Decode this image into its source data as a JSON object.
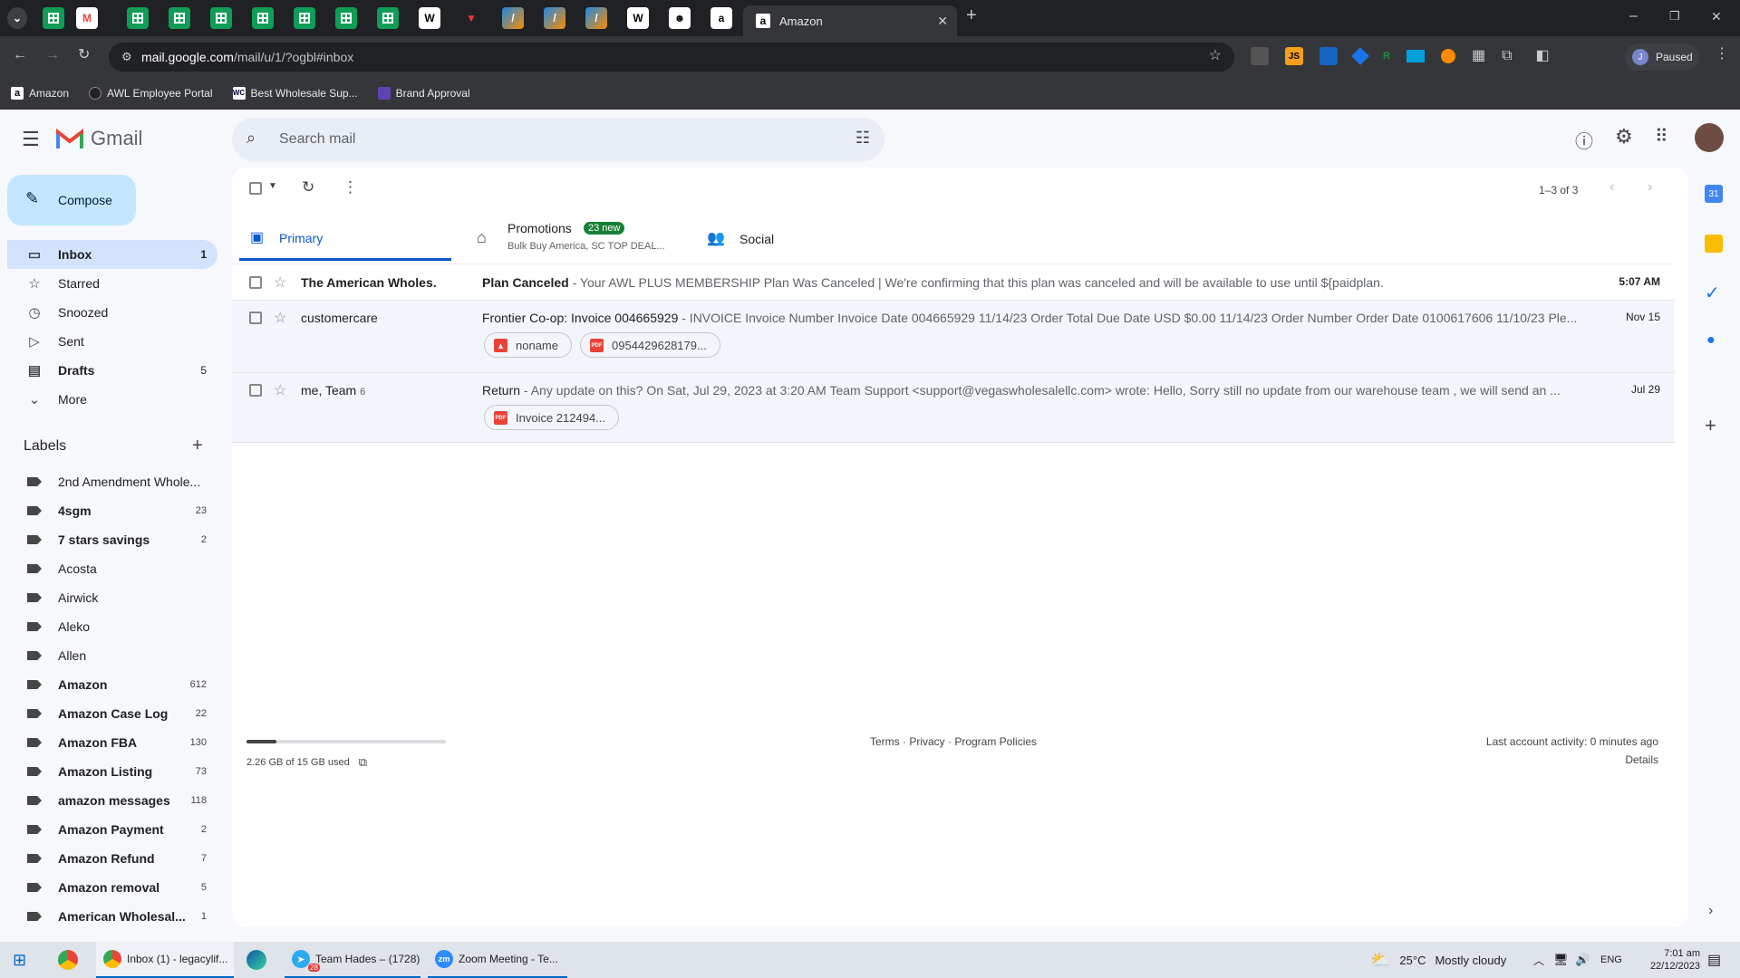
{
  "browser": {
    "active_tab_title": "Amazon",
    "url_host": "mail.google.com",
    "url_path": "/mail/u/1/?ogbl#inbox",
    "profile_status": "Paused",
    "profile_initial": "J",
    "bookmarks": [
      "Amazon",
      "AWL Employee Portal",
      "Best Wholesale Sup...",
      "Brand Approval"
    ]
  },
  "gmail": {
    "brand": "Gmail",
    "search_placeholder": "Search mail",
    "compose_label": "Compose",
    "pagination": "1–3 of 3",
    "nav": [
      {
        "label": "Inbox",
        "count": "1"
      },
      {
        "label": "Starred",
        "count": ""
      },
      {
        "label": "Snoozed",
        "count": ""
      },
      {
        "label": "Sent",
        "count": ""
      },
      {
        "label": "Drafts",
        "count": "5"
      },
      {
        "label": "More",
        "count": ""
      }
    ],
    "labels_heading": "Labels",
    "labels": [
      {
        "name": "2nd Amendment Whole...",
        "count": ""
      },
      {
        "name": "4sgm",
        "count": "23"
      },
      {
        "name": "7 stars savings",
        "count": "2"
      },
      {
        "name": "Acosta",
        "count": ""
      },
      {
        "name": "Airwick",
        "count": ""
      },
      {
        "name": "Aleko",
        "count": ""
      },
      {
        "name": "Allen",
        "count": ""
      },
      {
        "name": "Amazon",
        "count": "612"
      },
      {
        "name": "Amazon Case Log",
        "count": "22"
      },
      {
        "name": "Amazon FBA",
        "count": "130"
      },
      {
        "name": "Amazon Listing",
        "count": "73"
      },
      {
        "name": "amazon messages",
        "count": "118"
      },
      {
        "name": "Amazon Payment",
        "count": "2"
      },
      {
        "name": "Amazon Refund",
        "count": "7"
      },
      {
        "name": "Amazon removal",
        "count": "5"
      },
      {
        "name": "American Wholesal...",
        "count": "1"
      }
    ],
    "tabs": {
      "primary": "Primary",
      "promotions": "Promotions",
      "promotions_badge": "23 new",
      "promotions_sub": "Bulk Buy America, SC TOP DEAL...",
      "social": "Social"
    },
    "emails": [
      {
        "sender": "The American Wholes.",
        "subject": "Plan Canceled",
        "snippet": " - Your AWL PLUS MEMBERSHIP Plan Was Canceled | We're confirming that this plan was canceled and will be available to use until ${paidplan.",
        "date": "5:07 AM"
      },
      {
        "sender": "customercare",
        "subject": "Frontier Co-op: Invoice 004665929",
        "snippet": " - INVOICE Invoice Number Invoice Date 004665929 11/14/23 Order Total Due Date USD $0.00 11/14/23 Order Number Order Date 0100617606 11/10/23 Ple...",
        "date": "Nov 15",
        "att1": "noname",
        "att2": "0954429628179..."
      },
      {
        "sender": "me, Team",
        "sender_count": "6",
        "subject": "Return",
        "snippet": " - Any update on this? On Sat, Jul 29, 2023 at 3:20 AM Team Support <support@vegaswholesalellc.com> wrote: Hello, Sorry still no update from our warehouse team , we will send an ...",
        "date": "Jul 29",
        "att1": "Invoice 212494..."
      }
    ],
    "footer": {
      "storage": "2.26 GB of 15 GB used",
      "storage_fraction": 0.15,
      "links": "Terms · Privacy · Program Policies",
      "activity": "Last account activity: 0 minutes ago",
      "details": "Details"
    }
  },
  "taskbar": {
    "items": [
      "Inbox (1) - legacylif...",
      "Team Hades – (1728)",
      "Zoom Meeting - Te..."
    ],
    "weather": "25°C",
    "weather_text": "Mostly cloudy",
    "lang": "ENG",
    "time": "7:01 am",
    "date": "22/12/2023",
    "tg_badge": "28"
  }
}
